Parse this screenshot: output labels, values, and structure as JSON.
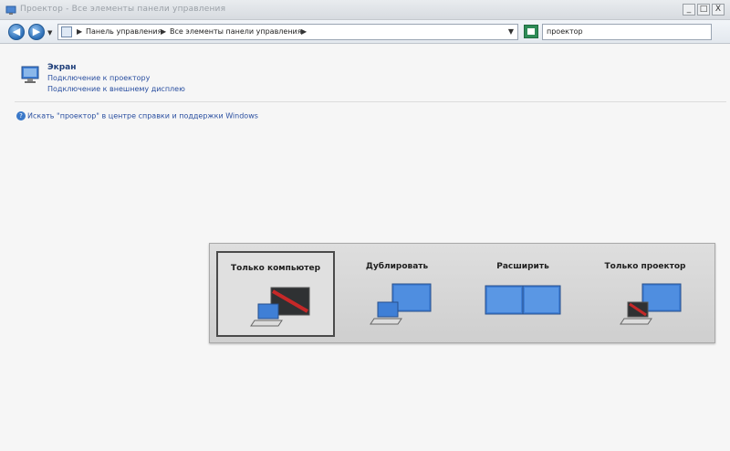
{
  "window": {
    "title": "Проектор - Все элементы панели управления",
    "buttons": {
      "minimize": "_",
      "maximize": "□",
      "close": "X"
    }
  },
  "address": {
    "back_glyph": "◀",
    "forward_glyph": "▶",
    "breadcrumbs": [
      "Панель управления",
      "Все элементы панели управления"
    ],
    "search_value": "проектор"
  },
  "results": {
    "title": "Экран",
    "links": [
      "Подключение к проектору",
      "Подключение к внешнему дисплею"
    ],
    "help_text": "Искать \"проектор\" в центре справки и поддержки Windows"
  },
  "projector": {
    "options": [
      {
        "label": "Только компьютер",
        "selected": true
      },
      {
        "label": "Дублировать",
        "selected": false
      },
      {
        "label": "Расширить",
        "selected": false
      },
      {
        "label": "Только проектор",
        "selected": false
      }
    ]
  },
  "colors": {
    "accent": "#2b6db6",
    "screen_blue": "#3f7fd6",
    "link": "#2a4fa0",
    "active_red": "#c62828"
  }
}
